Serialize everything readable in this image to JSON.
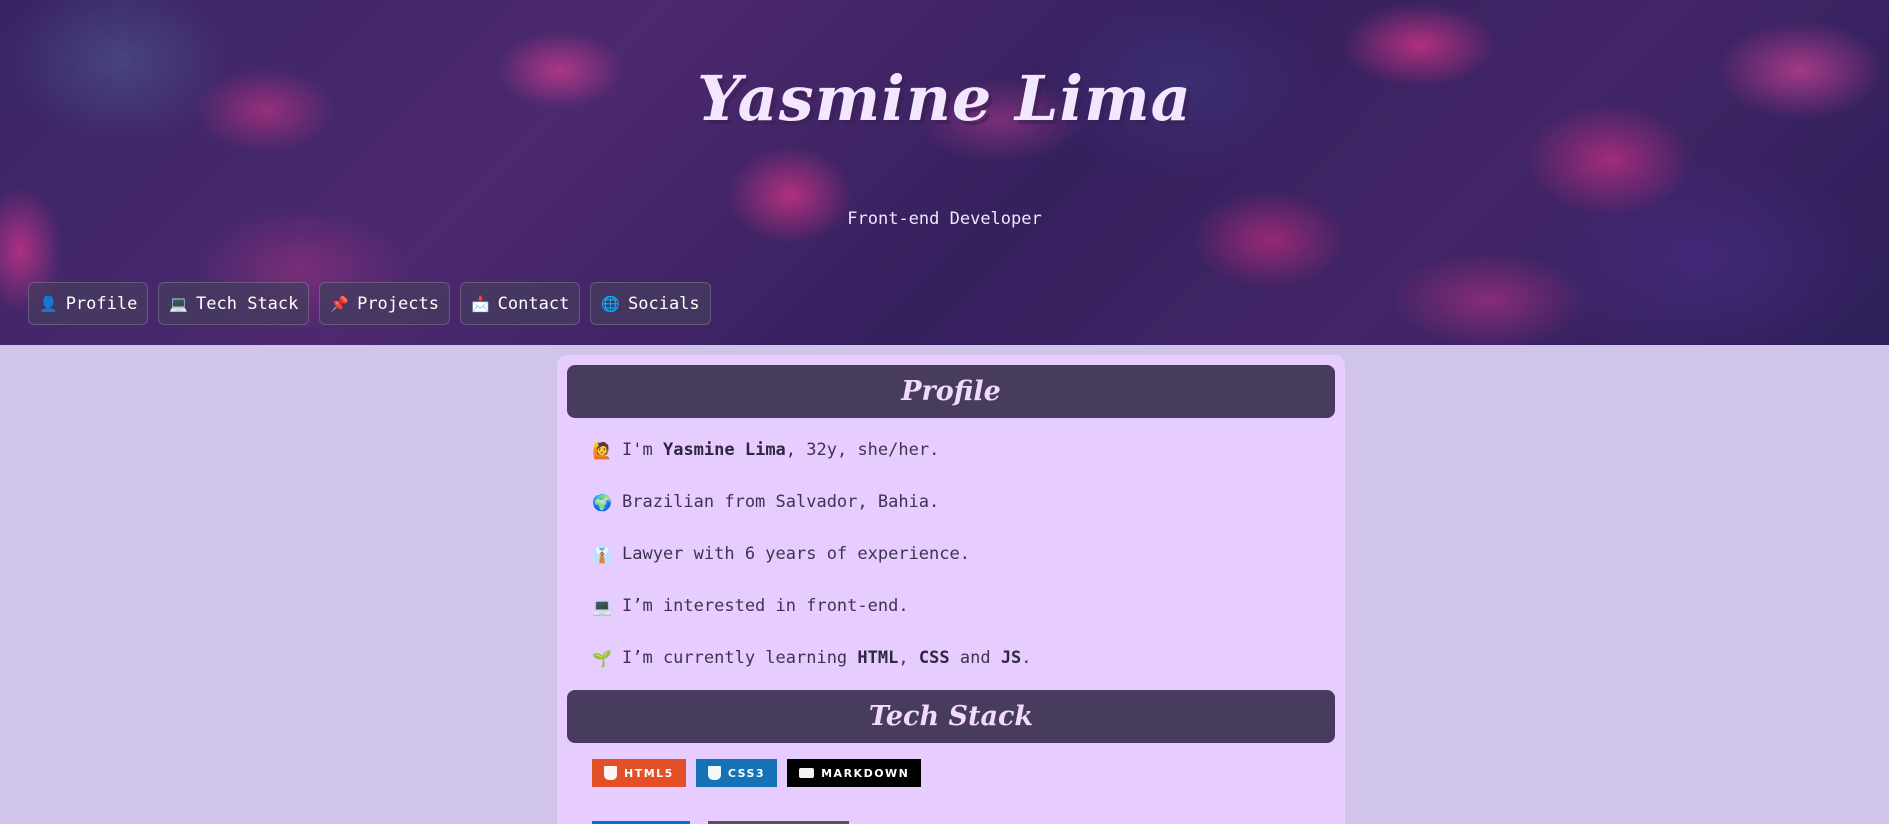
{
  "hero": {
    "title": "Yasmine Lima",
    "subtitle": "Front-end Developer"
  },
  "nav": {
    "items": [
      {
        "icon": "👤",
        "label": "Profile"
      },
      {
        "icon": "💻",
        "label": "Tech Stack"
      },
      {
        "icon": "📌",
        "label": "Projects"
      },
      {
        "icon": "📩",
        "label": "Contact"
      },
      {
        "icon": "🌐",
        "label": "Socials"
      }
    ]
  },
  "profile": {
    "heading": "Profile",
    "lines": [
      {
        "icon": "🙋",
        "pre": "I'm ",
        "bold": "Yasmine Lima",
        "post": ", 32y, she/her."
      },
      {
        "icon": "🌍",
        "text": "Brazilian from Salvador, Bahia."
      },
      {
        "icon": "👔",
        "text": "Lawyer with 6 years of experience."
      },
      {
        "icon": "💻",
        "text": "I’m interested in front-end."
      },
      {
        "icon": "🌱",
        "pre": "I’m currently learning ",
        "b1": "HTML",
        "s1": ", ",
        "b2": "CSS",
        "s2": " and ",
        "b3": "JS",
        "post": "."
      }
    ]
  },
  "tech": {
    "heading": "Tech Stack",
    "badges": [
      {
        "label": "HTML5",
        "color": "#e34f26",
        "icon": "html5-icon"
      },
      {
        "label": "CSS3",
        "color": "#1572b6",
        "icon": "css3-icon"
      },
      {
        "label": "MARKDOWN",
        "color": "#000000",
        "icon": "markdown-icon"
      }
    ],
    "row2_colors": [
      "#0a6fc9",
      "#555555"
    ]
  },
  "colors": {
    "background": "#d1c4ea",
    "card": "#e6ccff",
    "section_header": "#473c5e"
  }
}
